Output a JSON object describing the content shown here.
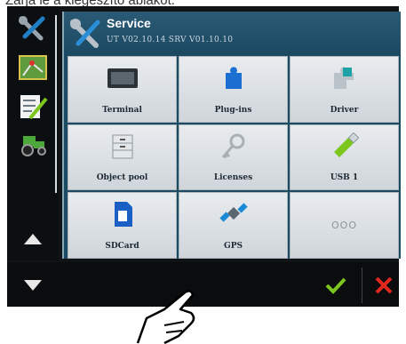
{
  "caption": "Zárja le a kiegészítő ablakot.",
  "header": {
    "title": "Service",
    "version": "UT V02.10.14 SRV V01.10.10",
    "icon": "wrench-screwdriver-icon"
  },
  "tiles": [
    {
      "label": "Terminal",
      "icon": "terminal-icon"
    },
    {
      "label": "Plug-ins",
      "icon": "puzzle-icon"
    },
    {
      "label": "Driver",
      "icon": "driver-puzzle-icon"
    },
    {
      "label": "Object pool",
      "icon": "cabinet-icon"
    },
    {
      "label": "Licenses",
      "icon": "key-icon"
    },
    {
      "label": "USB 1",
      "icon": "usb-stick-icon"
    },
    {
      "label": "SDCard",
      "icon": "sdcard-icon"
    },
    {
      "label": "GPS",
      "icon": "satellite-icon"
    },
    {
      "label": "",
      "more": "OOO",
      "icon": "more-icon"
    }
  ],
  "sidebar": [
    "wrench-screwdriver-icon",
    "map-icon",
    "checklist-icon",
    "tractor-icon"
  ],
  "colors": {
    "ok": "#7cc61e",
    "cancel": "#e5281e",
    "panel": "#1d4a63"
  }
}
